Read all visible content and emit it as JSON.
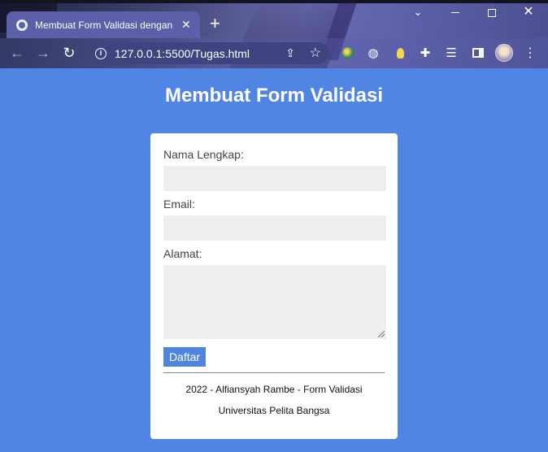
{
  "browser": {
    "tab_title": "Membuat Form Validasi dengan",
    "new_tab_label": "+",
    "url": "127.0.0.1:5500/Tugas.html",
    "icons": {
      "tab_favicon": "globe-icon",
      "back": "arrow-left-icon",
      "forward": "arrow-right-icon",
      "reload": "reload-icon",
      "site_info": "info-icon",
      "share": "share-icon",
      "bookmark": "star-icon",
      "extensions": [
        "globe-color-extension-icon",
        "globe-icon",
        "bulb-icon",
        "puzzle-icon",
        "playlist-icon",
        "side-panel-icon",
        "avatar",
        "kebab-menu-icon"
      ],
      "window": [
        "chevron-down-icon",
        "minimize-icon",
        "maximize-icon",
        "close-icon"
      ]
    }
  },
  "page": {
    "title": "Membuat Form Validasi",
    "form": {
      "nama_label": "Nama Lengkap:",
      "nama_value": "",
      "email_label": "Email:",
      "email_value": "",
      "alamat_label": "Alamat:",
      "alamat_value": "",
      "submit_label": "Daftar"
    },
    "footer": {
      "line1": "2022 - Alfiansyah Rambe - Form Validasi",
      "line2": "Universitas Pelita Bangsa"
    }
  },
  "colors": {
    "page_bg": "#5185e4",
    "button_bg": "#4f84e0",
    "field_bg": "#eeeeee"
  }
}
